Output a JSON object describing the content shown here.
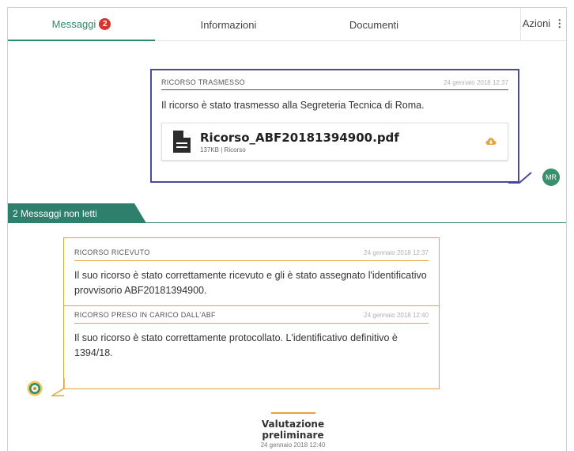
{
  "tabs": {
    "messages_label": "Messaggi",
    "messages_badge": "2",
    "info_label": "Informazioni",
    "docs_label": "Documenti",
    "actions_label": "Azioni",
    "actions_icon": "⋮"
  },
  "sent_message": {
    "title": "RICORSO TRASMESSO",
    "date": "24 gennaio 2018 12:37",
    "body": "Il ricorso è stato trasmesso alla Segreteria Tecnica di Roma.",
    "attachment": {
      "name": "Ricorso_ABF20181394900.pdf",
      "meta": "137KB | Ricorso",
      "icon": "document-icon",
      "action_icon": "cloud-download-icon"
    },
    "avatar": "MR"
  },
  "unread_divider": {
    "label": "2 Messaggi non letti"
  },
  "received_messages": [
    {
      "title": "RICORSO RICEVUTO",
      "date": "24 gennaio 2018 12:37",
      "body": "Il suo ricorso è stato correttamente ricevuto e gli è stato assegnato l'identificativo provvisorio ABF20181394900."
    },
    {
      "title": "RICORSO PRESO IN CARICO DALL'ABF",
      "date": "24 gennaio 2018 12:40",
      "body": "Il suo ricorso è stato correttamente protocollato. L'identificativo definitivo è 1394/18."
    }
  ],
  "status": {
    "title": "Valutazione preliminare",
    "date": "24 gennaio 2018 12:40"
  },
  "colors": {
    "accent_green": "#2e8a6d",
    "sent_border": "#4a4a9c",
    "received_border": "#e6a53c",
    "badge_red": "#d9332b"
  }
}
